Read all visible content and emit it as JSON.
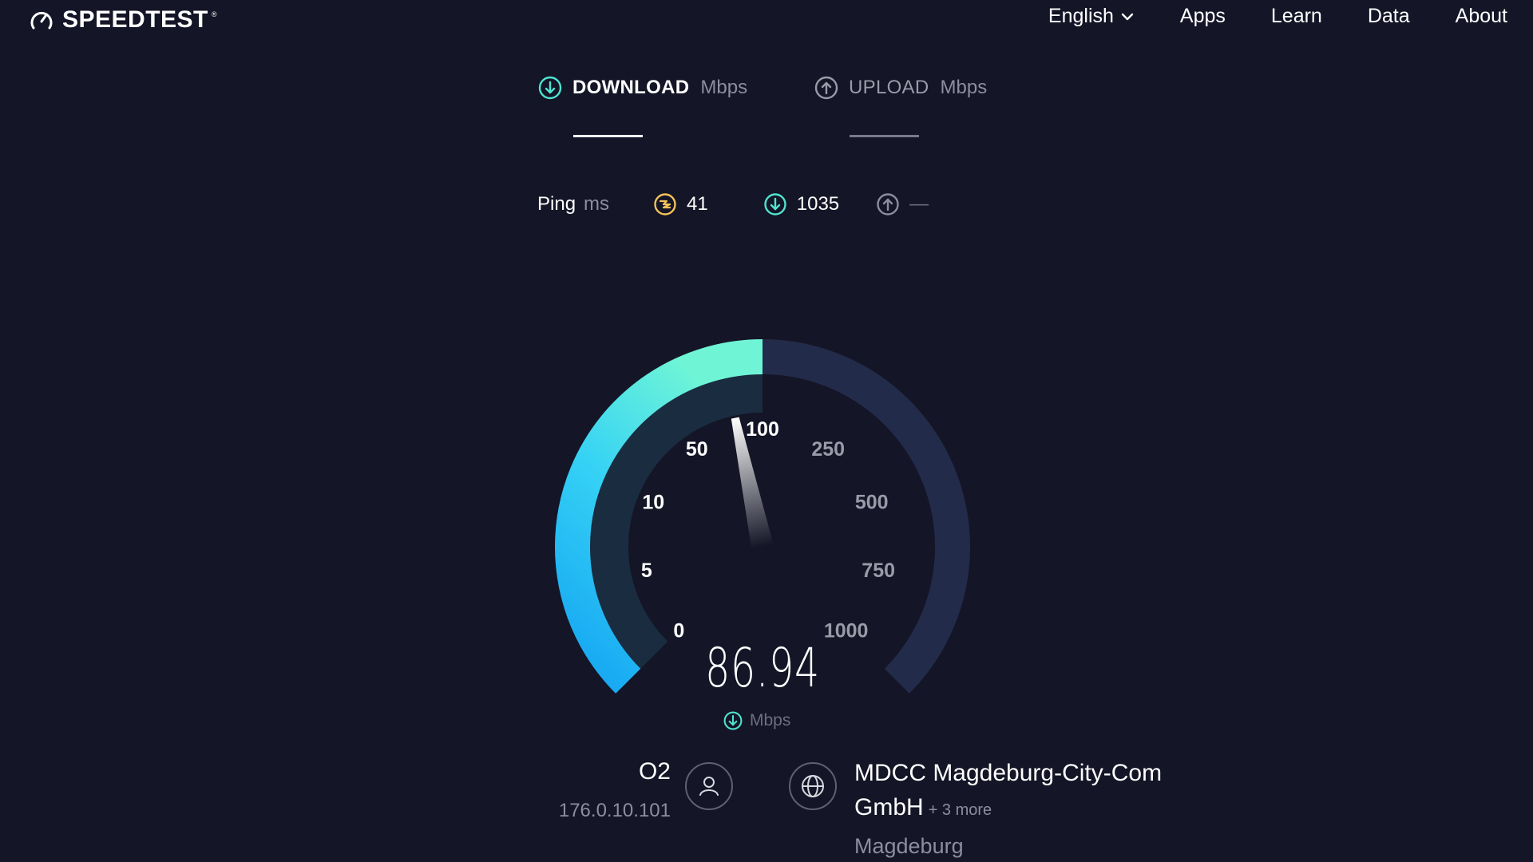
{
  "header": {
    "logo_text": "SPEEDTEST",
    "logo_tm": "®",
    "nav": {
      "language": "English",
      "apps": "Apps",
      "learn": "Learn",
      "data": "Data",
      "about": "About"
    }
  },
  "tabs": {
    "download": {
      "title": "DOWNLOAD",
      "unit": "Mbps"
    },
    "upload": {
      "title": "UPLOAD",
      "unit": "Mbps"
    }
  },
  "ping": {
    "label": "Ping",
    "unit": "ms",
    "jitter_value": "41",
    "download_ping_value": "1035",
    "upload_ping_value": "—"
  },
  "gauge": {
    "value": "86.94",
    "unit": "Mbps",
    "ticks": [
      "0",
      "5",
      "10",
      "50",
      "100",
      "250",
      "500",
      "750",
      "1000"
    ],
    "progress_fraction": 0.5,
    "colors": {
      "track": "#232b4a",
      "progress_start": "#1aa8f0",
      "progress_end": "#6cf5d8",
      "tick_active": "#ffffff",
      "tick_inactive": "#9a9aa8"
    }
  },
  "isp": {
    "name": "O2",
    "ip": "176.0.10.101"
  },
  "server": {
    "name": "MDCC Magdeburg-City-Com GmbH",
    "more": "+ 3 more",
    "location": "Magdeburg"
  },
  "icons": {
    "logo": "gauge-icon",
    "language_chevron": "chevron-down-icon",
    "download": "arrow-down-circle-icon",
    "upload": "arrow-up-circle-icon",
    "jitter": "jitter-icon",
    "user": "user-icon",
    "globe": "globe-icon"
  },
  "colors": {
    "background": "#141526",
    "accent_teal": "#4fe3d0",
    "jitter_yellow": "#f3c35a",
    "muted": "#8d8da0"
  }
}
